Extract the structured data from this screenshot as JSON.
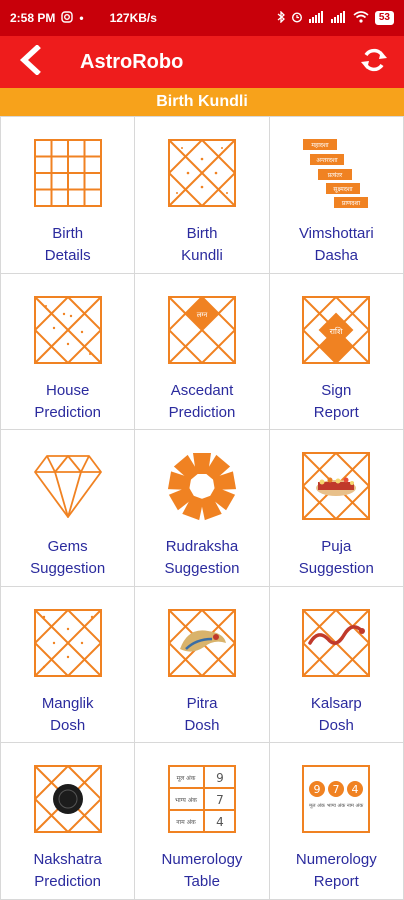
{
  "status_bar": {
    "time": "2:58 PM",
    "speed": "127KB/s",
    "battery": "53"
  },
  "app_bar": {
    "title": "AstroRobo",
    "back_icon": "back-arrow-icon",
    "refresh_icon": "refresh-icon"
  },
  "section": {
    "title": "Birth Kundli"
  },
  "colors": {
    "status_bar": "#c8000a",
    "app_bar": "#ee1c1c",
    "section_header": "#f7a21b",
    "icon_orange": "#f08222",
    "label_blue": "#2b2b9e"
  },
  "tiles": [
    {
      "label": "Birth\nDetails",
      "icon": "grid-chart-icon"
    },
    {
      "label": "Birth\nKundli",
      "icon": "kundli-chart-icon"
    },
    {
      "label": "Vimshottari\nDasha",
      "icon": "dasha-steps-icon"
    },
    {
      "label": "House\nPrediction",
      "icon": "house-chart-icon"
    },
    {
      "label": "Ascedant\nPrediction",
      "icon": "ascendant-chart-icon"
    },
    {
      "label": "Sign\nReport",
      "icon": "sign-chart-icon"
    },
    {
      "label": "Gems\nSuggestion",
      "icon": "gem-icon"
    },
    {
      "label": "Rudraksha\nSuggestion",
      "icon": "rudraksha-icon"
    },
    {
      "label": "Puja\nSuggestion",
      "icon": "puja-chart-icon"
    },
    {
      "label": "Manglik\nDosh",
      "icon": "manglik-chart-icon"
    },
    {
      "label": "Pitra\nDosh",
      "icon": "pitra-chart-icon"
    },
    {
      "label": "Kalsarp\nDosh",
      "icon": "kalsarp-chart-icon"
    },
    {
      "label": "Nakshatra\nPrediction",
      "icon": "nakshatra-chart-icon"
    },
    {
      "label": "Numerology\nTable",
      "icon": "numerology-table-icon"
    },
    {
      "label": "Numerology\nReport",
      "icon": "numerology-report-icon"
    }
  ],
  "icon_text": {
    "dasha_steps": [
      "महादशा",
      "अन्तरदशा",
      "प्रत्यंतर",
      "सूक्ष्मदशा",
      "प्राणदशा"
    ],
    "ascendant_center": "लग्न",
    "sign_center": "राशि",
    "numerology_table": [
      {
        "label": "मूल अंक",
        "value": "9"
      },
      {
        "label": "भाग्य अंक",
        "value": "7"
      },
      {
        "label": "नाम अंक",
        "value": "4"
      }
    ],
    "numerology_report": [
      {
        "value": "9",
        "label": "मूल अंक"
      },
      {
        "value": "7",
        "label": "भाग्य अंक"
      },
      {
        "value": "4",
        "label": "नाम अंक"
      }
    ]
  }
}
